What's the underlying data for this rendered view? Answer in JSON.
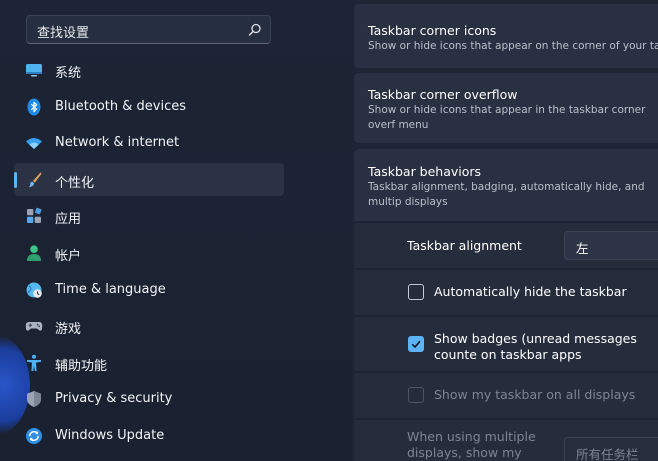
{
  "search": {
    "placeholder": "查找设置"
  },
  "sidebar": {
    "items": [
      {
        "label": "系统",
        "icon": "system-monitor-icon"
      },
      {
        "label": "Bluetooth & devices",
        "icon": "bluetooth-icon"
      },
      {
        "label": "Network & internet",
        "icon": "wifi-icon"
      },
      {
        "label": "个性化",
        "icon": "paintbrush-icon",
        "active": true
      },
      {
        "label": "应用",
        "icon": "apps-icon"
      },
      {
        "label": "帐户",
        "icon": "person-icon"
      },
      {
        "label": "Time & language",
        "icon": "globe-clock-icon"
      },
      {
        "label": "游戏",
        "icon": "gamepad-icon"
      },
      {
        "label": "辅助功能",
        "icon": "accessibility-icon"
      },
      {
        "label": "Privacy & security",
        "icon": "shield-icon"
      },
      {
        "label": "Windows Update",
        "icon": "update-icon"
      }
    ]
  },
  "main": {
    "corner_icons": {
      "title": "Taskbar corner icons",
      "desc": "Show or hide icons that appear on the corner of your taskb"
    },
    "corner_overflow": {
      "title": "Taskbar corner overflow",
      "desc": "Show or hide icons that appear in the taskbar corner overf menu"
    },
    "behaviors": {
      "title": "Taskbar behaviors",
      "desc": "Taskbar alignment, badging, automatically hide, and multip displays"
    },
    "alignment": {
      "label": "Taskbar alignment",
      "value": "左"
    },
    "auto_hide": {
      "label": "Automatically hide the taskbar",
      "checked": false
    },
    "badges": {
      "label": "Show badges (unread messages counte on taskbar apps",
      "checked": true
    },
    "all_displays": {
      "label": "Show my taskbar on all displays",
      "checked": false
    },
    "multi_display": {
      "label": "When using multiple displays, show my",
      "value": "所有任务栏"
    }
  },
  "colors": {
    "accent": "#5cb4f5",
    "background": "#1a2232",
    "card": "#283041"
  }
}
